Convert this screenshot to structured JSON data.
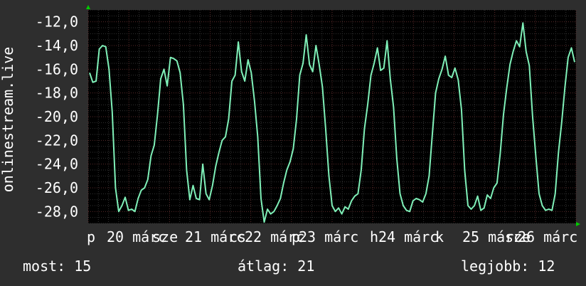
{
  "chart_data": {
    "type": "line",
    "ylabel": "onlinestream.live",
    "ylim": [
      -29,
      -11
    ],
    "yticks": [
      "-12,0",
      "-14,0",
      "-16,0",
      "-18,0",
      "-20,0",
      "-22,0",
      "-24,0",
      "-26,0",
      "-28,0"
    ],
    "xtick_labels": [
      "p",
      "20 márc",
      "sze",
      "21 márc",
      "cs",
      "22 márc",
      "p",
      "23 márc",
      "h",
      "24 márc",
      "k",
      "25 márc",
      "sze",
      "26 márc"
    ],
    "line_color": "#7ff0b8",
    "background": "#000000",
    "grid": true,
    "series": [
      {
        "values": [
          -16.3,
          -17.1,
          -17.0,
          -14.3,
          -14.0,
          -14.1,
          -16.0,
          -19.6,
          -26.0,
          -28.0,
          -27.5,
          -26.8,
          -27.9,
          -27.8,
          -28.0,
          -26.9,
          -26.2,
          -26.0,
          -25.3,
          -23.3,
          -22.4,
          -19.8,
          -16.8,
          -16.0,
          -17.4,
          -15.0,
          -15.1,
          -15.3,
          -16.3,
          -19.0,
          -24.5,
          -27.0,
          -25.8,
          -26.9,
          -27.0,
          -24.0,
          -26.5,
          -27.0,
          -25.8,
          -24.2,
          -23.0,
          -22.0,
          -21.7,
          -20.2,
          -17.0,
          -16.5,
          -13.7,
          -16.2,
          -17.0,
          -15.2,
          -16.3,
          -18.7,
          -21.7,
          -26.9,
          -28.9,
          -27.8,
          -28.2,
          -28.0,
          -27.5,
          -26.9,
          -25.6,
          -24.5,
          -23.8,
          -22.7,
          -20.2,
          -16.5,
          -15.5,
          -13.1,
          -15.6,
          -16.2,
          -14.0,
          -15.6,
          -17.5,
          -21.0,
          -25.0,
          -27.5,
          -28.0,
          -27.7,
          -28.2,
          -27.6,
          -27.8,
          -27.1,
          -26.7,
          -26.5,
          -24.5,
          -21.0,
          -19.0,
          -16.5,
          -15.5,
          -14.2,
          -16.1,
          -15.9,
          -13.6,
          -16.8,
          -19.2,
          -23.5,
          -26.5,
          -27.5,
          -27.9,
          -28.0,
          -27.1,
          -26.9,
          -27.0,
          -27.2,
          -26.5,
          -25.0,
          -21.5,
          -18.0,
          -16.8,
          -16.0,
          -14.9,
          -16.5,
          -16.7,
          -15.9,
          -16.9,
          -19.4,
          -24.5,
          -27.5,
          -27.8,
          -27.5,
          -26.7,
          -27.9,
          -27.7,
          -26.6,
          -26.9,
          -26.0,
          -25.6,
          -23.1,
          -19.8,
          -17.6,
          -15.6,
          -14.5,
          -13.6,
          -14.1,
          -12.1,
          -14.5,
          -15.7,
          -20.0,
          -23.3,
          -26.5,
          -27.5,
          -27.9,
          -27.8,
          -27.9,
          -26.5,
          -23.0,
          -20.5,
          -17.5,
          -15.0,
          -14.2,
          -15.4
        ]
      }
    ]
  },
  "stats": {
    "now": "most: 15",
    "avg": "átlag: 21",
    "max": "legjobb: 12"
  }
}
